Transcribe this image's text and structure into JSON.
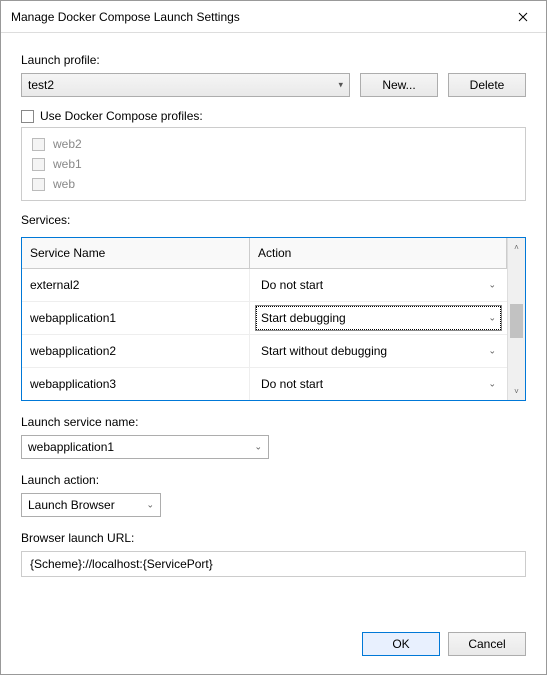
{
  "window": {
    "title": "Manage Docker Compose Launch Settings"
  },
  "launch_profile": {
    "label": "Launch profile:",
    "value": "test2",
    "new_label": "New...",
    "delete_label": "Delete"
  },
  "use_profiles": {
    "label": "Use Docker Compose profiles:",
    "items": [
      "web2",
      "web1",
      "web"
    ]
  },
  "services": {
    "label": "Services:",
    "columns": {
      "name": "Service Name",
      "action": "Action"
    },
    "rows": [
      {
        "name": "external2",
        "action": "Do not start",
        "focused": false
      },
      {
        "name": "webapplication1",
        "action": "Start debugging",
        "focused": true
      },
      {
        "name": "webapplication2",
        "action": "Start without debugging",
        "focused": false
      },
      {
        "name": "webapplication3",
        "action": "Do not start",
        "focused": false
      }
    ]
  },
  "launch_service_name": {
    "label": "Launch service name:",
    "value": "webapplication1"
  },
  "launch_action": {
    "label": "Launch action:",
    "value": "Launch Browser"
  },
  "browser_url": {
    "label": "Browser launch URL:",
    "value": "{Scheme}://localhost:{ServicePort}"
  },
  "footer": {
    "ok": "OK",
    "cancel": "Cancel"
  }
}
